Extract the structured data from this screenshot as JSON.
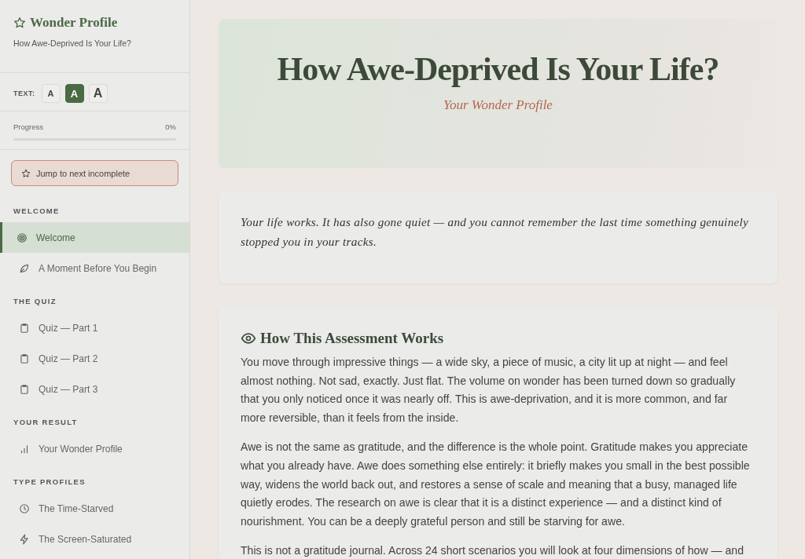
{
  "sidebar": {
    "title": "Wonder Profile",
    "subtitle": "How Awe-Deprived Is Your Life?",
    "text_size": {
      "label": "TEXT:",
      "options": [
        {
          "label": "A",
          "selected": false
        },
        {
          "label": "A",
          "selected": true
        },
        {
          "label": "A",
          "selected": false
        }
      ]
    },
    "progress": {
      "label": "Progress",
      "reading": "0%",
      "level": 0
    },
    "jump_button": "Jump to next incomplete",
    "sections": [
      {
        "heading": "WELCOME",
        "items": [
          {
            "label": "Welcome",
            "selected": true
          },
          {
            "label": "A Moment Before You Begin",
            "selected": false
          }
        ]
      },
      {
        "heading": "THE QUIZ",
        "items": [
          {
            "label": "Quiz — Part 1",
            "selected": false
          },
          {
            "label": "Quiz — Part 2",
            "selected": false
          },
          {
            "label": "Quiz — Part 3",
            "selected": false
          }
        ]
      },
      {
        "heading": "YOUR RESULT",
        "items": [
          {
            "label": "Your Wonder Profile",
            "selected": false
          }
        ]
      },
      {
        "heading": "TYPE PROFILES",
        "items": [
          {
            "label": "The Time-Starved",
            "selected": false
          },
          {
            "label": "The Screen-Saturated",
            "selected": false
          }
        ]
      }
    ]
  },
  "hero": {
    "title": "How Awe-Deprived Is Your Life?",
    "subtitle": "Your Wonder Profile"
  },
  "intro": "Your life works. It has also gone quiet — and you cannot remember the last time something genuinely stopped you in your tracks.",
  "section": {
    "heading": "How This Assessment Works",
    "paragraphs": [
      "You move through impressive things — a wide sky, a piece of music, a city lit up at night — and feel almost nothing. Not sad, exactly. Just flat. The volume on wonder has been turned down so gradually that you only noticed once it was nearly off. This is awe-deprivation, and it is more common, and far more reversible, than it feels from the inside.",
      "Awe is not the same as gratitude, and the difference is the whole point. Gratitude makes you appreciate what you already have. Awe does something else entirely: it briefly makes you small in the best possible way, widens the world back out, and restores a sense of scale and meaning that a busy, managed life quietly erodes. The research on awe is clear that it is a distinct experience — and a distinct kind of nourishment. You can be a deeply grateful person and still be starving for awe.",
      "This is not a gratitude journal. Across 24 short scenarios you will look at four dimensions of how — and"
    ]
  }
}
